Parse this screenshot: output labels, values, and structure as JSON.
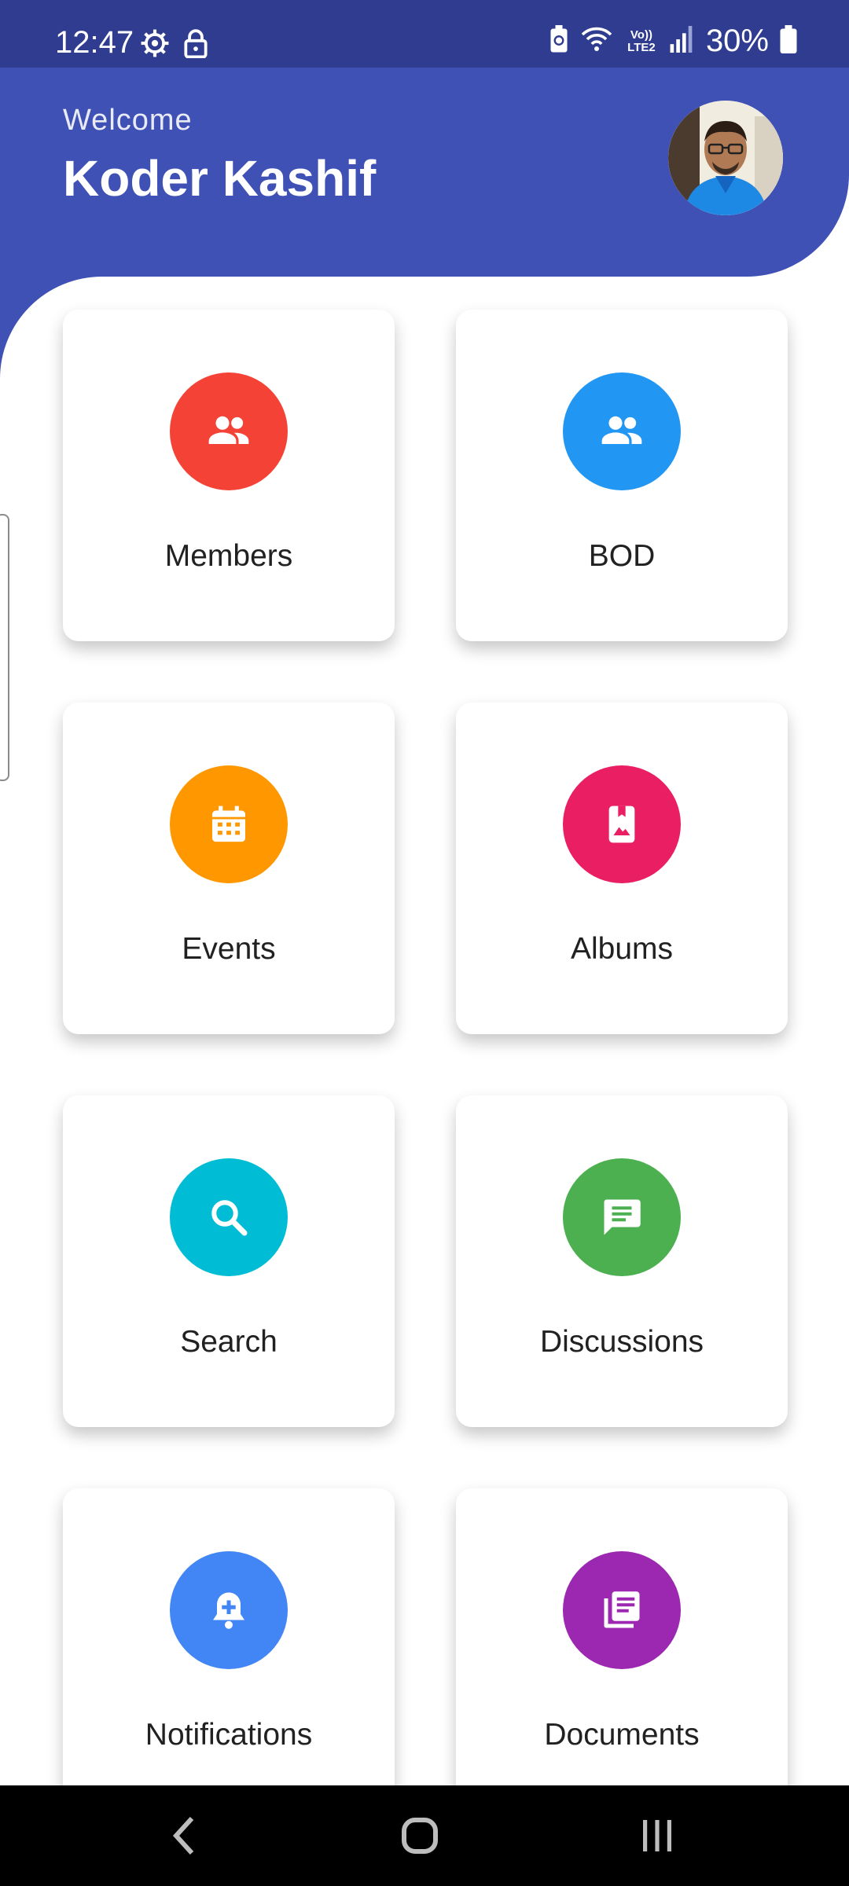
{
  "status_bar": {
    "time": "12:47",
    "battery_percent": "30%",
    "network_label": "Vo)) LTE2",
    "icons": [
      "settings-icon",
      "lock-icon",
      "battery-saver-icon",
      "wifi-icon",
      "volte-icon",
      "signal-icon",
      "battery-icon"
    ]
  },
  "header": {
    "welcome": "Welcome",
    "user_name": "Koder Kashif"
  },
  "tiles": [
    {
      "label": "Members",
      "icon": "people-icon",
      "color": "#f44336"
    },
    {
      "label": "BOD",
      "icon": "people-icon",
      "color": "#2196f3"
    },
    {
      "label": "Events",
      "icon": "calendar-icon",
      "color": "#ff9800"
    },
    {
      "label": "Albums",
      "icon": "photo-book-icon",
      "color": "#e91e63"
    },
    {
      "label": "Search",
      "icon": "search-icon",
      "color": "#00bcd4"
    },
    {
      "label": "Discussions",
      "icon": "chat-icon",
      "color": "#4caf50"
    },
    {
      "label": "Notifications",
      "icon": "add-alert-icon",
      "color": "#4285f4"
    },
    {
      "label": "Documents",
      "icon": "library-books-icon",
      "color": "#9c27b0"
    }
  ],
  "colors": {
    "status_bar": "#2f3c8f",
    "header": "#3f51b5"
  },
  "nav_bar": {
    "icons": [
      "back-icon",
      "home-icon",
      "recents-icon"
    ]
  }
}
